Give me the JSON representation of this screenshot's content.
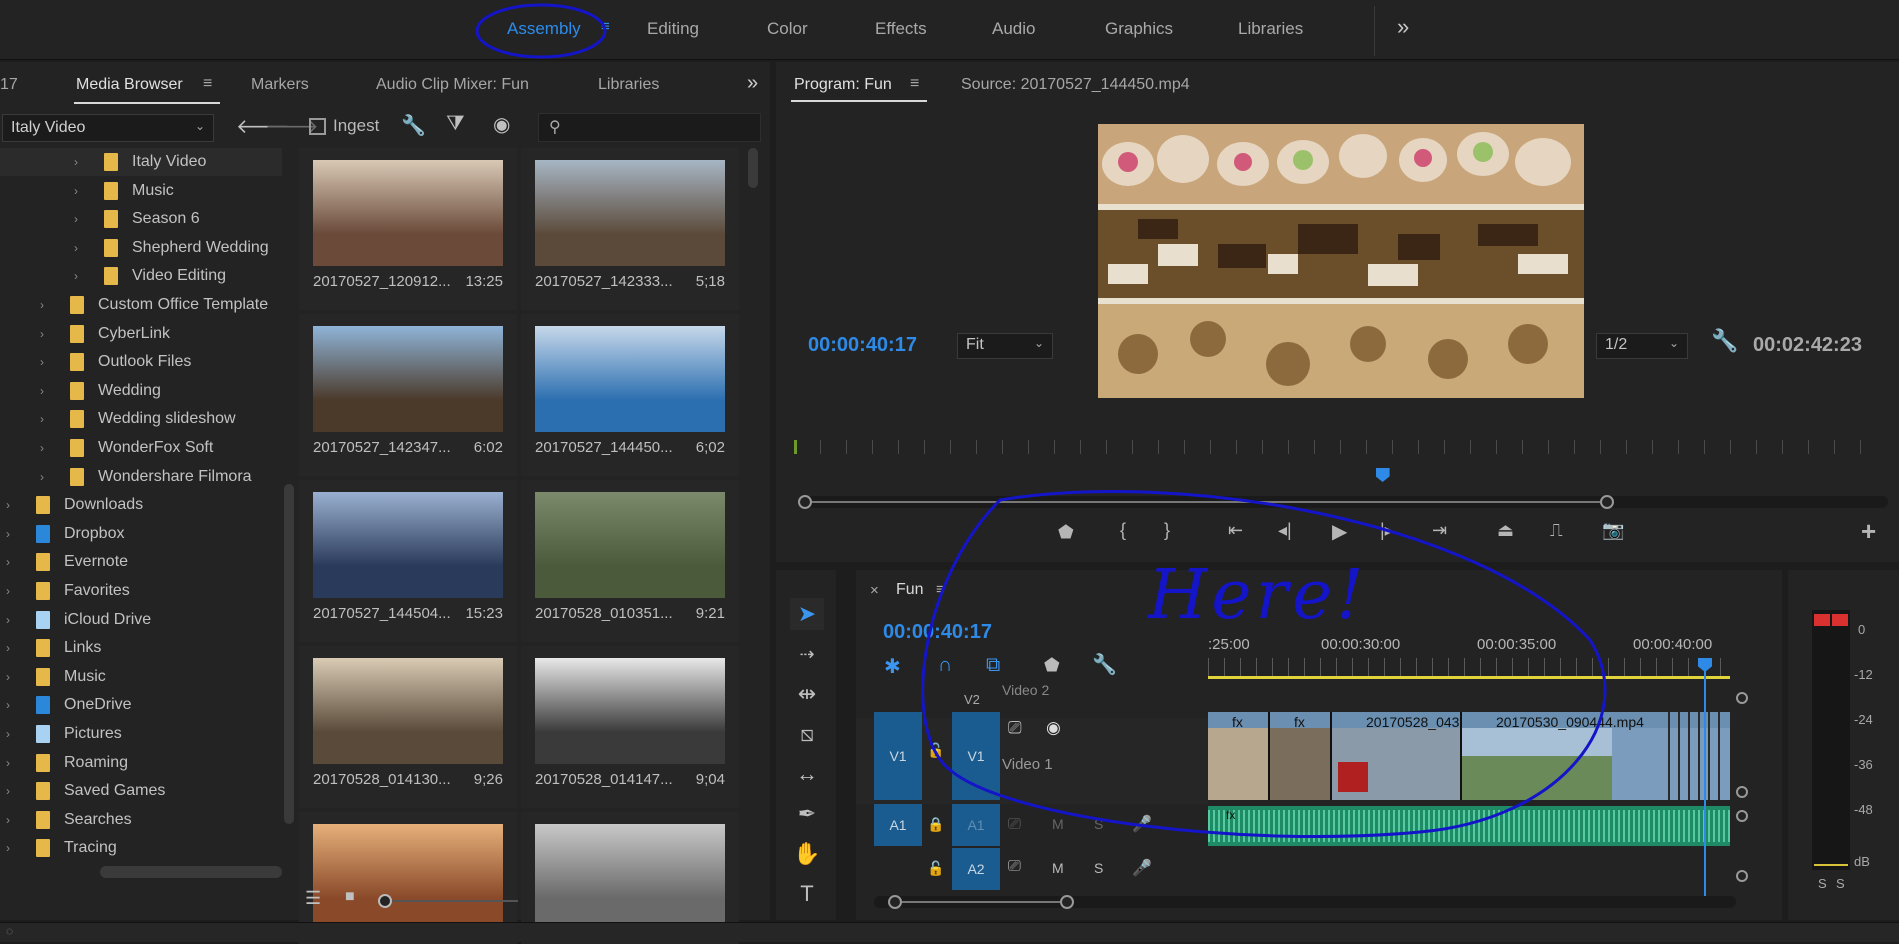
{
  "workspaces": {
    "tabs": [
      "Assembly",
      "Editing",
      "Color",
      "Effects",
      "Audio",
      "Graphics",
      "Libraries"
    ],
    "active": "Assembly",
    "more": "»"
  },
  "media_browser": {
    "tab_partial": "17",
    "tabs": [
      "Media Browser",
      "Markers",
      "Audio Clip Mixer: Fun",
      "Libraries"
    ],
    "location": "Italy Video",
    "ingest_label": "Ingest",
    "tree": [
      {
        "label": "Italy Video",
        "level": 2,
        "selected": true
      },
      {
        "label": "Music",
        "level": 2
      },
      {
        "label": "Season 6",
        "level": 2
      },
      {
        "label": "Shepherd Wedding",
        "level": 2
      },
      {
        "label": "Video Editing",
        "level": 2
      },
      {
        "label": "Custom Office Template",
        "level": 1
      },
      {
        "label": "CyberLink",
        "level": 1
      },
      {
        "label": "Outlook Files",
        "level": 1
      },
      {
        "label": "Wedding",
        "level": 1
      },
      {
        "label": "Wedding slideshow",
        "level": 1
      },
      {
        "label": "WonderFox Soft",
        "level": 1
      },
      {
        "label": "Wondershare Filmora",
        "level": 1
      },
      {
        "label": "Downloads",
        "level": 0
      },
      {
        "label": "Dropbox",
        "level": 0
      },
      {
        "label": "Evernote",
        "level": 0
      },
      {
        "label": "Favorites",
        "level": 0
      },
      {
        "label": "iCloud Drive",
        "level": 0
      },
      {
        "label": "Links",
        "level": 0
      },
      {
        "label": "Music",
        "level": 0
      },
      {
        "label": "OneDrive",
        "level": 0
      },
      {
        "label": "Pictures",
        "level": 0
      },
      {
        "label": "Roaming",
        "level": 0
      },
      {
        "label": "Saved Games",
        "level": 0
      },
      {
        "label": "Searches",
        "level": 0
      },
      {
        "label": "Tracing",
        "level": 0
      }
    ],
    "thumbs": [
      {
        "name": "20170527_120912...",
        "dur": "13:25"
      },
      {
        "name": "20170527_142333...",
        "dur": "5;18"
      },
      {
        "name": "20170527_142347...",
        "dur": "6:02"
      },
      {
        "name": "20170527_144450...",
        "dur": "6;02"
      },
      {
        "name": "20170527_144504...",
        "dur": "15:23"
      },
      {
        "name": "20170528_010351...",
        "dur": "9:21"
      },
      {
        "name": "20170528_014130...",
        "dur": "9;26"
      },
      {
        "name": "20170528_014147...",
        "dur": "9;04"
      },
      {
        "name": "",
        "dur": ""
      },
      {
        "name": "",
        "dur": ""
      }
    ]
  },
  "program": {
    "tab": "Program: Fun",
    "source_tab": "Source: 20170527_144450.mp4",
    "timecode": "00:00:40:17",
    "fit": "Fit",
    "resolution": "1/2",
    "duration": "00:02:42:23",
    "playhead_fraction": 0.54,
    "add_button": "+"
  },
  "timeline": {
    "close": "×",
    "name": "Fun",
    "timecode": "00:00:40:17",
    "ruler": [
      ":25:00",
      "00:00:30:00",
      "00:00:35:00",
      "00:00:40:00"
    ],
    "tracks": {
      "v2_label": "V2",
      "v2_name": "Video 2",
      "v1_source": "V1",
      "v1_label": "V1",
      "v1_name": "Video 1",
      "a1_source": "A1",
      "a1_label": "A1",
      "a2_label": "A2",
      "m": "M",
      "s": "S"
    },
    "clips": [
      {
        "name": "fx"
      },
      {
        "name": "fx"
      },
      {
        "name": "20170528_043"
      },
      {
        "name": "20170530_090444.mp4"
      }
    ],
    "fx_badge": "fx"
  },
  "meter": {
    "labels": [
      "0",
      "-12",
      "-24",
      "-36",
      "-48",
      "dB"
    ],
    "solo": [
      "S",
      "S"
    ]
  },
  "annotation": {
    "text": "Here!",
    "color": "#1414c8"
  }
}
